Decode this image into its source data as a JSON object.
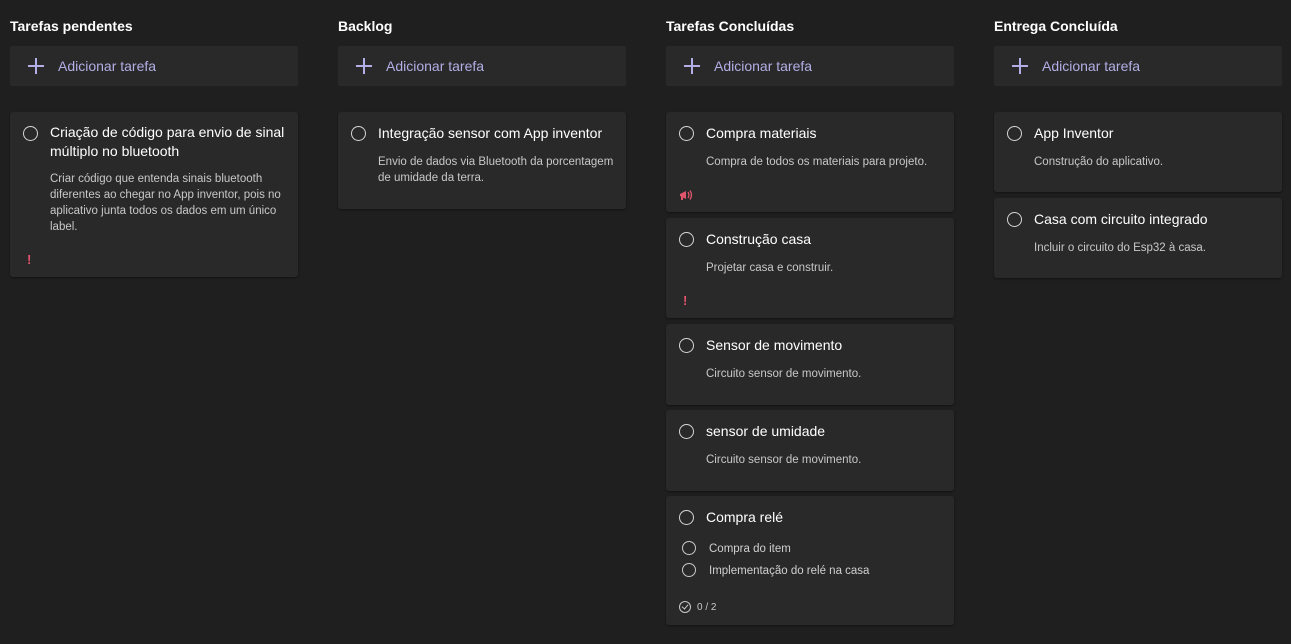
{
  "add_task_label": "Adicionar tarefa",
  "colors": {
    "background": "#1f1f1f",
    "card": "#292929",
    "accent": "#b3aee6",
    "priority": "#e0556b"
  },
  "columns": [
    {
      "title": "Tarefas pendentes",
      "cards": [
        {
          "title": "Criação de código para envio de sinal múltiplo no bluetooth",
          "description": "Criar código que entenda sinais bluetooth diferentes ao chegar no App inventor, pois no aplicativo junta todos os dados em um único label.",
          "icon": "exclamation-icon",
          "icon_glyph": "!"
        }
      ]
    },
    {
      "title": "Backlog",
      "cards": [
        {
          "title": "Integração sensor com App inventor",
          "description": "Envio de dados via Bluetooth da porcentagem de umidade da terra."
        }
      ]
    },
    {
      "title": "Tarefas Concluídas",
      "cards": [
        {
          "title": "Compra materiais",
          "description": "Compra de todos os materiais para projeto.",
          "icon": "megaphone-icon"
        },
        {
          "title": "Construção casa",
          "description": "Projetar casa e construir.",
          "icon": "exclamation-icon",
          "icon_glyph": "!"
        },
        {
          "title": "Sensor de movimento",
          "description": "Circuito sensor de movimento."
        },
        {
          "title": "sensor de umidade",
          "description": "Circuito sensor de movimento."
        },
        {
          "title": "Compra relé",
          "checklist": [
            {
              "label": "Compra do item"
            },
            {
              "label": "Implementação do relé na casa"
            }
          ],
          "progress": "0 / 2",
          "progress_icon": "checklist-progress-icon"
        }
      ]
    },
    {
      "title": "Entrega Concluída",
      "cards": [
        {
          "title": "App Inventor",
          "description": "Construção do aplicativo."
        },
        {
          "title": "Casa com circuito integrado",
          "description": "Incluir o circuito do Esp32 à casa."
        }
      ]
    }
  ]
}
